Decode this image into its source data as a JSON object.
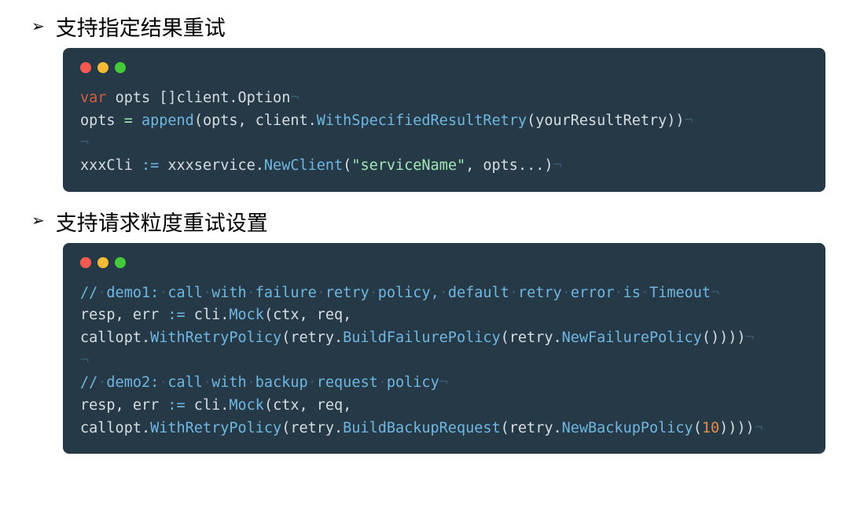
{
  "sections": [
    {
      "heading": "支持指定结果重试",
      "code_tokens": [
        [
          {
            "t": "var",
            "c": "tok-kw"
          },
          {
            "t": " ",
            "c": "tok-id"
          },
          {
            "t": "opts []client",
            "c": "tok-id"
          },
          {
            "t": ".",
            "c": "tok-punc"
          },
          {
            "t": "Option",
            "c": "tok-type"
          },
          {
            "t": "¬",
            "c": "tok-nl"
          }
        ],
        [
          {
            "t": "opts ",
            "c": "tok-id"
          },
          {
            "t": "=",
            "c": "tok-op"
          },
          {
            "t": " ",
            "c": "tok-id"
          },
          {
            "t": "append",
            "c": "tok-fn"
          },
          {
            "t": "(opts, client",
            "c": "tok-id"
          },
          {
            "t": ".",
            "c": "tok-punc"
          },
          {
            "t": "WithSpecifiedResultRetry",
            "c": "tok-fn"
          },
          {
            "t": "(yourResultRetry))",
            "c": "tok-id"
          },
          {
            "t": "¬",
            "c": "tok-nl"
          }
        ],
        [
          {
            "t": "¬",
            "c": "tok-nl"
          }
        ],
        [
          {
            "t": "xxxCli ",
            "c": "tok-id"
          },
          {
            "t": ":=",
            "c": "tok-assign"
          },
          {
            "t": " xxxservice",
            "c": "tok-id"
          },
          {
            "t": ".",
            "c": "tok-punc"
          },
          {
            "t": "NewClient",
            "c": "tok-fn"
          },
          {
            "t": "(",
            "c": "tok-punc"
          },
          {
            "t": "\"serviceName\"",
            "c": "tok-str"
          },
          {
            "t": ", opts",
            "c": "tok-id"
          },
          {
            "t": "...",
            "c": "tok-punc"
          },
          {
            "t": ")",
            "c": "tok-punc"
          },
          {
            "t": "¬",
            "c": "tok-nl"
          }
        ]
      ]
    },
    {
      "heading": "支持请求粒度重试设置",
      "code_tokens": [
        [
          {
            "t": "//",
            "c": "tok-cm"
          },
          {
            "t": "·",
            "c": "tok-dot-sp"
          },
          {
            "t": "demo1:",
            "c": "tok-cm"
          },
          {
            "t": "·",
            "c": "tok-dot-sp"
          },
          {
            "t": "call",
            "c": "tok-cm"
          },
          {
            "t": "·",
            "c": "tok-dot-sp"
          },
          {
            "t": "with",
            "c": "tok-cm"
          },
          {
            "t": "·",
            "c": "tok-dot-sp"
          },
          {
            "t": "failure",
            "c": "tok-cm"
          },
          {
            "t": "·",
            "c": "tok-dot-sp"
          },
          {
            "t": "retry",
            "c": "tok-cm"
          },
          {
            "t": "·",
            "c": "tok-dot-sp"
          },
          {
            "t": "policy,",
            "c": "tok-cm"
          },
          {
            "t": "·",
            "c": "tok-dot-sp"
          },
          {
            "t": "default",
            "c": "tok-cm"
          },
          {
            "t": "·",
            "c": "tok-dot-sp"
          },
          {
            "t": "retry",
            "c": "tok-cm"
          },
          {
            "t": "·",
            "c": "tok-dot-sp"
          },
          {
            "t": "error",
            "c": "tok-cm"
          },
          {
            "t": "·",
            "c": "tok-dot-sp"
          },
          {
            "t": "is",
            "c": "tok-cm"
          },
          {
            "t": "·",
            "c": "tok-dot-sp"
          },
          {
            "t": "Timeout",
            "c": "tok-cm"
          },
          {
            "t": "¬",
            "c": "tok-nl"
          }
        ],
        [
          {
            "t": "resp, err ",
            "c": "tok-id"
          },
          {
            "t": ":=",
            "c": "tok-assign"
          },
          {
            "t": " cli",
            "c": "tok-id"
          },
          {
            "t": ".",
            "c": "tok-punc"
          },
          {
            "t": "Mock",
            "c": "tok-fn"
          },
          {
            "t": "(ctx, req,",
            "c": "tok-id"
          }
        ],
        [
          {
            "t": "callopt",
            "c": "tok-id"
          },
          {
            "t": ".",
            "c": "tok-punc"
          },
          {
            "t": "WithRetryPolicy",
            "c": "tok-fn"
          },
          {
            "t": "(retry",
            "c": "tok-id"
          },
          {
            "t": ".",
            "c": "tok-punc"
          },
          {
            "t": "BuildFailurePolicy",
            "c": "tok-fn"
          },
          {
            "t": "(retry",
            "c": "tok-id"
          },
          {
            "t": ".",
            "c": "tok-punc"
          },
          {
            "t": "NewFailurePolicy",
            "c": "tok-fn"
          },
          {
            "t": "())))",
            "c": "tok-id"
          },
          {
            "t": "¬",
            "c": "tok-nl"
          }
        ],
        [
          {
            "t": "¬",
            "c": "tok-nl"
          }
        ],
        [
          {
            "t": "//",
            "c": "tok-cm"
          },
          {
            "t": "·",
            "c": "tok-dot-sp"
          },
          {
            "t": "demo2:",
            "c": "tok-cm"
          },
          {
            "t": "·",
            "c": "tok-dot-sp"
          },
          {
            "t": "call",
            "c": "tok-cm"
          },
          {
            "t": "·",
            "c": "tok-dot-sp"
          },
          {
            "t": "with",
            "c": "tok-cm"
          },
          {
            "t": "·",
            "c": "tok-dot-sp"
          },
          {
            "t": "backup",
            "c": "tok-cm"
          },
          {
            "t": "·",
            "c": "tok-dot-sp"
          },
          {
            "t": "request",
            "c": "tok-cm"
          },
          {
            "t": "·",
            "c": "tok-dot-sp"
          },
          {
            "t": "policy",
            "c": "tok-cm"
          },
          {
            "t": "¬",
            "c": "tok-nl"
          }
        ],
        [
          {
            "t": "resp, err ",
            "c": "tok-id"
          },
          {
            "t": ":=",
            "c": "tok-assign"
          },
          {
            "t": " cli",
            "c": "tok-id"
          },
          {
            "t": ".",
            "c": "tok-punc"
          },
          {
            "t": "Mock",
            "c": "tok-fn"
          },
          {
            "t": "(ctx, req,",
            "c": "tok-id"
          }
        ],
        [
          {
            "t": "callopt",
            "c": "tok-id"
          },
          {
            "t": ".",
            "c": "tok-punc"
          },
          {
            "t": "WithRetryPolicy",
            "c": "tok-fn"
          },
          {
            "t": "(retry",
            "c": "tok-id"
          },
          {
            "t": ".",
            "c": "tok-punc"
          },
          {
            "t": "BuildBackupRequest",
            "c": "tok-fn"
          },
          {
            "t": "(retry",
            "c": "tok-id"
          },
          {
            "t": ".",
            "c": "tok-punc"
          },
          {
            "t": "NewBackupPolicy",
            "c": "tok-fn"
          },
          {
            "t": "(",
            "c": "tok-id"
          },
          {
            "t": "10",
            "c": "tok-num"
          },
          {
            "t": "))))",
            "c": "tok-id"
          },
          {
            "t": "¬",
            "c": "tok-nl"
          }
        ]
      ]
    }
  ]
}
